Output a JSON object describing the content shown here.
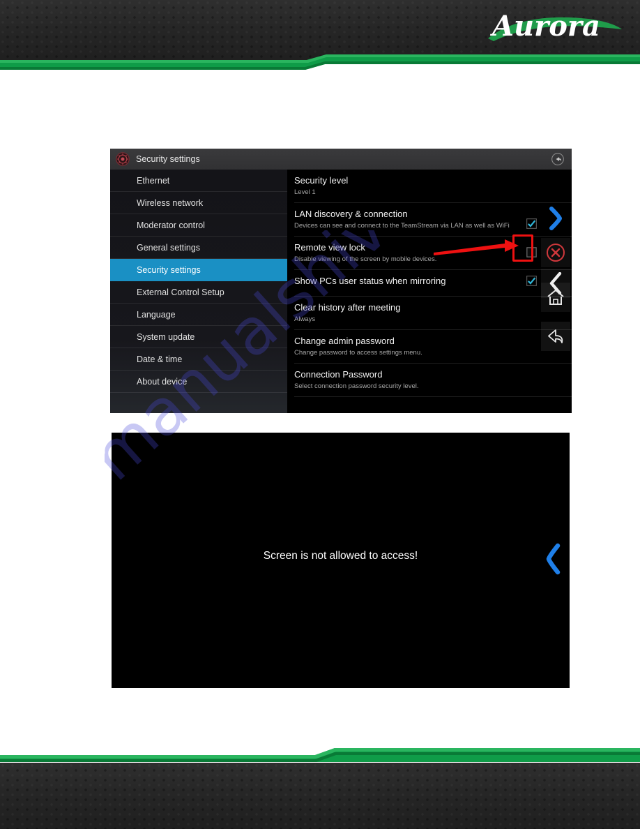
{
  "brand": {
    "logo_text": "Aurora",
    "faint_caption": ""
  },
  "watermark": {
    "text": "manualshive.com"
  },
  "settings_window": {
    "title_bar": {
      "title": "Security settings",
      "app_icon": "settings-gear-icon",
      "right_icon": "undo-circle-icon"
    },
    "sidebar": {
      "items": [
        {
          "label": "Ethernet",
          "active": false
        },
        {
          "label": "Wireless network",
          "active": false
        },
        {
          "label": "Moderator control",
          "active": false
        },
        {
          "label": "General settings",
          "active": false
        },
        {
          "label": "Security settings",
          "active": true
        },
        {
          "label": "External Control Setup",
          "active": false
        },
        {
          "label": "Language",
          "active": false
        },
        {
          "label": "System update",
          "active": false
        },
        {
          "label": "Date & time",
          "active": false
        },
        {
          "label": "About device",
          "active": false
        }
      ],
      "active_color": "#1a90c4"
    },
    "rows": [
      {
        "title": "Security level",
        "subtitle": "Level 1",
        "has_checkbox": false,
        "checked": false
      },
      {
        "title": "LAN discovery & connection",
        "subtitle": "Devices can see and connect to the TeamStream via LAN as well as WiFi",
        "has_checkbox": true,
        "checked": true
      },
      {
        "title": "Remote view lock",
        "subtitle": "Disable viewing of the screen by mobile devices.",
        "has_checkbox": true,
        "checked": false
      },
      {
        "title": "Show PCs user status when mirroring",
        "subtitle": "",
        "has_checkbox": true,
        "checked": true
      },
      {
        "title": "Clear history after meeting",
        "subtitle": "Always",
        "has_checkbox": false,
        "checked": false
      },
      {
        "title": "Change admin password",
        "subtitle": "Change password to access settings menu.",
        "has_checkbox": false,
        "checked": false
      },
      {
        "title": "Connection Password",
        "subtitle": "Select connection password security level.",
        "has_checkbox": false,
        "checked": false
      }
    ],
    "nav_buttons": [
      {
        "icon": "chevron-right-blue-icon",
        "color": "#1f7fe8"
      },
      {
        "icon": "close-circle-red-icon",
        "color": "#d0383c"
      },
      {
        "icon": "chevron-left-white-icon",
        "color": "#ffffff"
      },
      {
        "icon": "home-icon",
        "color": "#ffffff"
      },
      {
        "icon": "back-arrow-icon",
        "color": "#ffffff"
      }
    ],
    "annotation": {
      "arrow_color": "#ee1111",
      "highlight_color": "#ee1111",
      "points_at": "remote-view-lock-checkbox"
    },
    "checkbox_checked_color": "#2fb6d8"
  },
  "black_screen": {
    "message": "Screen is not allowed to access!",
    "chevron_icon": "chevron-left-blue-icon",
    "chevron_color": "#1f7fe8"
  }
}
